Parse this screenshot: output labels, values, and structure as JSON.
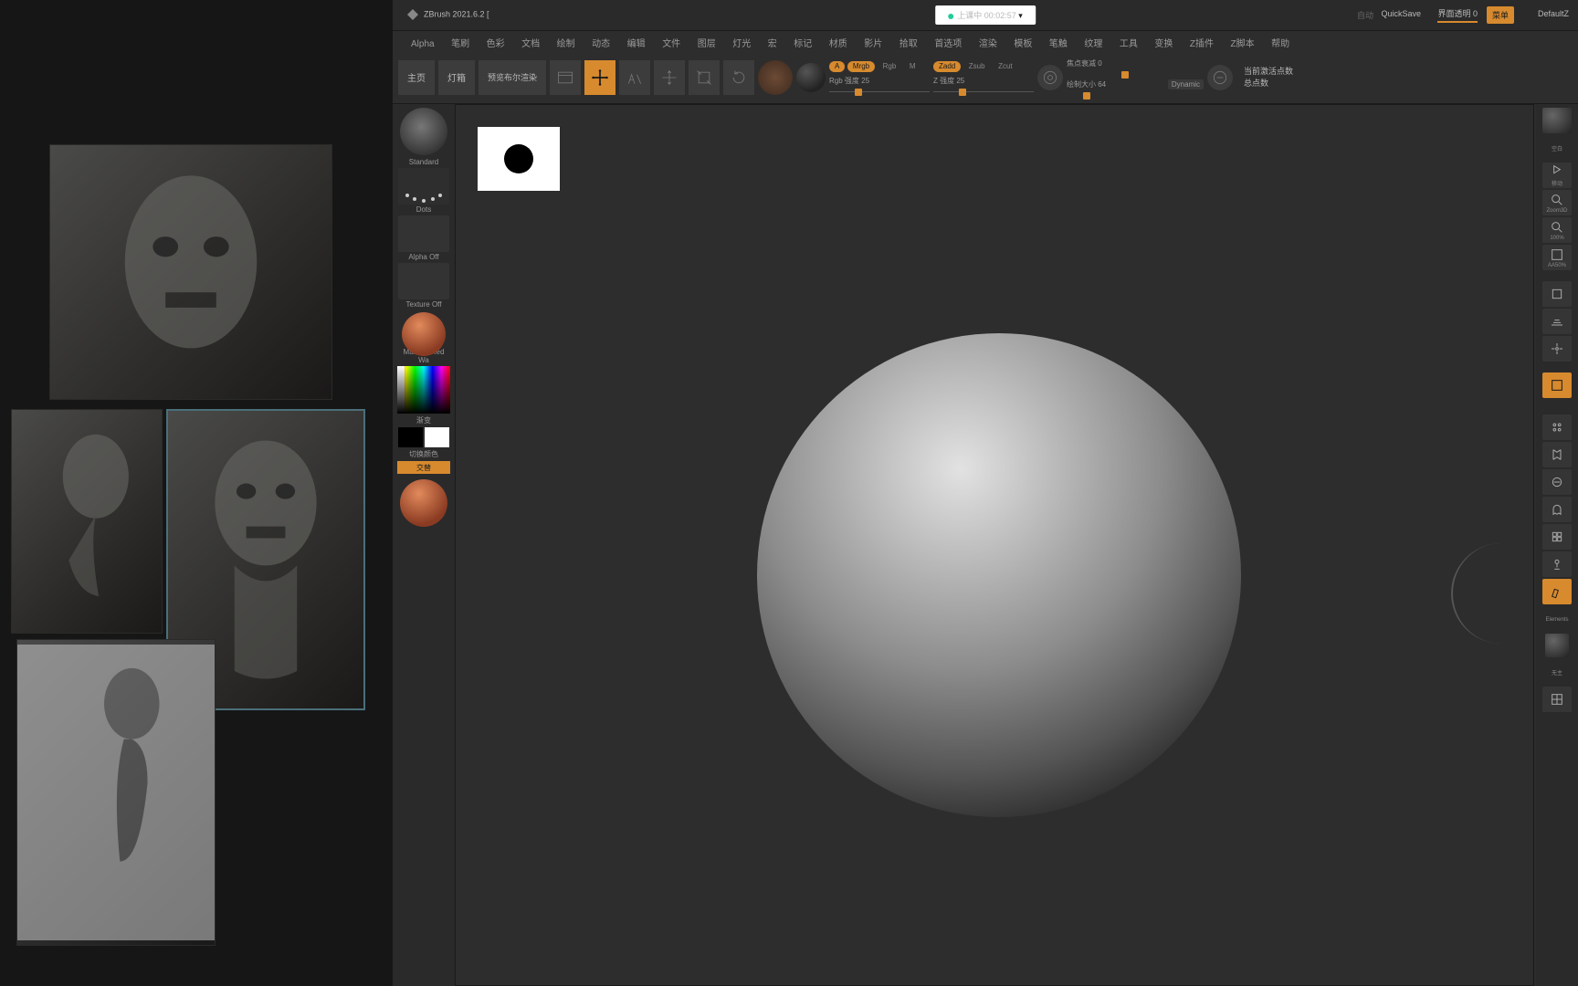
{
  "app_title": "ZBrush 2021.6.2 [",
  "doc_tab": "上课中 00:02:57",
  "top_right": {
    "auto": "自动",
    "quicksave": "QuickSave",
    "render_trans": "界面透明 0",
    "menu": "菜单",
    "default": "DefaultZ"
  },
  "menus": [
    "Alpha",
    "笔刷",
    "色彩",
    "文档",
    "绘制",
    "动态",
    "编辑",
    "文件",
    "图层",
    "灯光",
    "宏",
    "标记",
    "材质",
    "影片",
    "拾取",
    "首选项",
    "渲染",
    "模板",
    "笔触",
    "纹理",
    "工具",
    "变换",
    "Z插件",
    "Z脚本",
    "帮助"
  ],
  "shelf": {
    "home": "主页",
    "dengxiang": "灯箱",
    "bool": "预览布尔渲染",
    "mode_chips": {
      "a": "A",
      "mrgb": "Mrgb",
      "rgb": "Rgb",
      "m": "M",
      "zadd": "Zadd",
      "zsub": "Zsub",
      "zcut": "Zcut"
    },
    "rgb_label": "Rgb 强度 25",
    "z_label": "Z 强度 25",
    "focal_label": "焦点衰减 0",
    "draw_label": "绘制大小 64",
    "dynamic": "Dynamic",
    "stats_top": "当前激活点数",
    "stats_bot": "总点数"
  },
  "palette": {
    "brush": "Standard",
    "stroke": "Dots",
    "alpha": "Alpha Off",
    "texture": "Texture Off",
    "material": "MatCap Red Wa",
    "gradient": "渐变",
    "swapcolor": "切换颜色",
    "swap": "交替"
  },
  "right_tips": {
    "kongbai": "空白",
    "move": "移动",
    "zoom": "Zoom3D",
    "fit": "100%",
    "aa": "AA50%"
  },
  "right_tips2": {
    "elements": "Elements",
    "wuzhu": "无主"
  }
}
